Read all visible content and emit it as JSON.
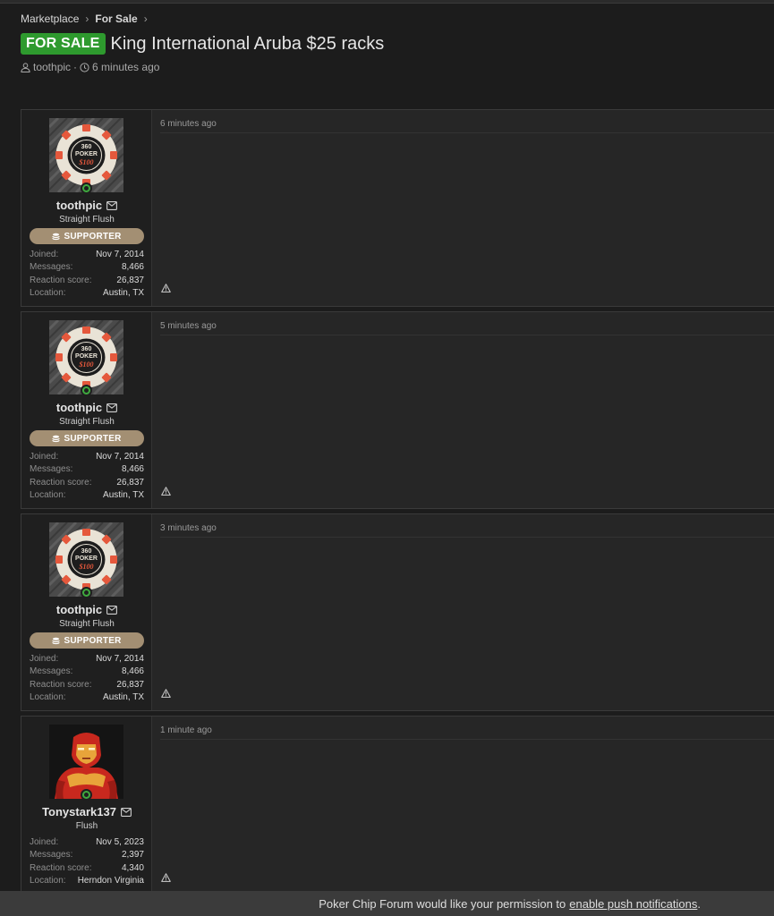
{
  "breadcrumb": {
    "items": [
      "Marketplace",
      "For Sale"
    ]
  },
  "thread": {
    "prefix": "FOR SALE",
    "title": "King International Aruba $25 racks",
    "author": "toothpic",
    "time": "6 minutes ago"
  },
  "stat_labels": {
    "joined": "Joined:",
    "messages": "Messages:",
    "reaction": "Reaction score:",
    "location": "Location:"
  },
  "posts": [
    {
      "time": "6 minutes ago",
      "user": {
        "name": "toothpic",
        "title": "Straight Flush",
        "badge": "SUPPORTER",
        "joined": "Nov 7, 2014",
        "messages": "8,466",
        "reaction": "26,837",
        "location": "Austin, TX",
        "avatar": "poker-chip-avatar"
      }
    },
    {
      "time": "5 minutes ago",
      "user": {
        "name": "toothpic",
        "title": "Straight Flush",
        "badge": "SUPPORTER",
        "joined": "Nov 7, 2014",
        "messages": "8,466",
        "reaction": "26,837",
        "location": "Austin, TX",
        "avatar": "poker-chip-avatar"
      }
    },
    {
      "time": "3 minutes ago",
      "user": {
        "name": "toothpic",
        "title": "Straight Flush",
        "badge": "SUPPORTER",
        "joined": "Nov 7, 2014",
        "messages": "8,466",
        "reaction": "26,837",
        "location": "Austin, TX",
        "avatar": "poker-chip-avatar"
      }
    },
    {
      "time": "1 minute ago",
      "user": {
        "name": "Tonystark137",
        "title": "Flush",
        "joined": "Nov 5, 2023",
        "messages": "2,397",
        "reaction": "4,340",
        "location": "Herndon Virginia",
        "avatar": "iron-man-avatar"
      }
    }
  ],
  "chip_text": {
    "top": "360",
    "middle": "POKER",
    "value": "$100"
  },
  "push": {
    "text": "Poker Chip Forum would like your permission to",
    "link": "enable push notifications",
    "end": "."
  },
  "colors": {
    "prefix_badge": "#2e9a2e",
    "supporter_badge": "#a38f73",
    "online": "#3faa3f",
    "background": "#1c1c1c"
  }
}
